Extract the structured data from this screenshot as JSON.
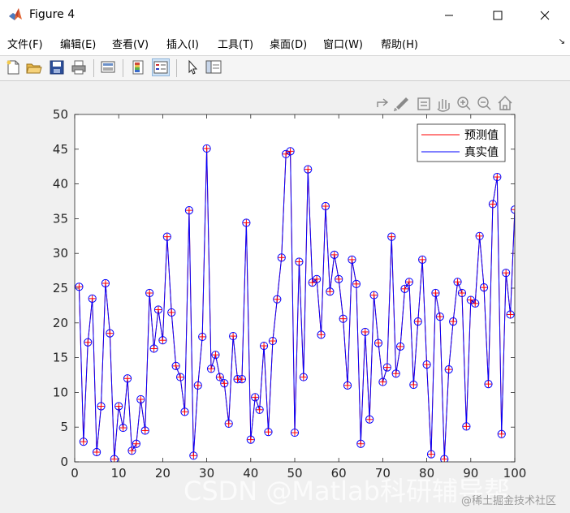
{
  "window": {
    "title": "Figure 4",
    "controls": {
      "minimize": "—",
      "maximize": "☐",
      "close": "✕"
    }
  },
  "menubar": {
    "items": [
      "文件(F)",
      "编辑(E)",
      "查看(V)",
      "插入(I)",
      "工具(T)",
      "桌面(D)",
      "窗口(W)",
      "帮助(H)"
    ]
  },
  "toolbar": {
    "buttons": [
      "new-figure-icon",
      "open-file-icon",
      "save-icon",
      "print-icon",
      "print-preview-icon",
      "colorbar-icon",
      "legend-icon",
      "pointer-icon",
      "property-inspector-icon"
    ]
  },
  "axes_toolbar": {
    "buttons": [
      "export-icon",
      "brush-icon",
      "data-tips-icon",
      "pan-icon",
      "zoom-in-icon",
      "zoom-out-icon",
      "home-icon"
    ]
  },
  "chart_data": {
    "type": "line",
    "xlim": [
      0,
      100
    ],
    "ylim": [
      0,
      50
    ],
    "xticks": [
      0,
      10,
      20,
      30,
      40,
      50,
      60,
      70,
      80,
      90,
      100
    ],
    "yticks": [
      0,
      5,
      10,
      15,
      20,
      25,
      30,
      35,
      40,
      45,
      50
    ],
    "grid": false,
    "legend_position": "top-right",
    "x": [
      1,
      2,
      3,
      4,
      5,
      6,
      7,
      8,
      9,
      10,
      11,
      12,
      13,
      14,
      15,
      16,
      17,
      18,
      19,
      20,
      21,
      22,
      23,
      24,
      25,
      26,
      27,
      28,
      29,
      30,
      31,
      32,
      33,
      34,
      35,
      36,
      37,
      38,
      39,
      40,
      41,
      42,
      43,
      44,
      45,
      46,
      47,
      48,
      49,
      50,
      51,
      52,
      53,
      54,
      55,
      56,
      57,
      58,
      59,
      60,
      61,
      62,
      63,
      64,
      65,
      66,
      67,
      68,
      69,
      70,
      71,
      72,
      73,
      74,
      75,
      76,
      77,
      78,
      79,
      80,
      81,
      82,
      83,
      84,
      85,
      86,
      87,
      88,
      89,
      90,
      91,
      92,
      93,
      94,
      95,
      96,
      97,
      98,
      99,
      100
    ],
    "series": [
      {
        "name": "预测值",
        "color": "#ff0000",
        "marker": "+",
        "values": [
          25.2,
          2.9,
          17.2,
          23.5,
          1.4,
          8,
          25.7,
          18.5,
          0.4,
          8,
          4.9,
          12,
          1.6,
          2.6,
          9,
          4.5,
          24.3,
          16.3,
          21.9,
          17.5,
          32.4,
          21.5,
          13.8,
          12.2,
          7.2,
          36.2,
          0.9,
          11,
          18,
          45.1,
          13.4,
          15.4,
          12.2,
          11.3,
          5.5,
          18.1,
          11.9,
          11.9,
          34.4,
          3.2,
          9.3,
          7.5,
          16.7,
          4.3,
          17.4,
          23.4,
          29.4,
          44.3,
          44.7,
          4.2,
          28.8,
          12.2,
          42.1,
          25.8,
          26.3,
          18.3,
          36.8,
          24.5,
          29.8,
          26.3,
          20.6,
          11,
          29.1,
          25.6,
          2.6,
          18.7,
          6.1,
          24,
          17.1,
          11.5,
          13.6,
          32.4,
          12.7,
          16.6,
          24.9,
          25.9,
          11.1,
          20.2,
          29.1,
          14,
          1.1,
          24.3,
          20.9,
          0.4,
          13.3,
          20.2,
          25.9,
          24.3,
          5.1,
          23.3,
          22.8,
          32.5,
          25.1,
          11.2,
          37.1,
          41,
          4,
          27.2,
          21.2,
          36.3
        ]
      },
      {
        "name": "真实值",
        "color": "#0000ff",
        "marker": "o",
        "values": [
          25.2,
          2.9,
          17.2,
          23.5,
          1.4,
          8,
          25.7,
          18.5,
          0.4,
          8,
          4.9,
          12,
          1.6,
          2.6,
          9,
          4.5,
          24.3,
          16.3,
          21.9,
          17.5,
          32.4,
          21.5,
          13.8,
          12.2,
          7.2,
          36.2,
          0.9,
          11,
          18,
          45.1,
          13.4,
          15.4,
          12.2,
          11.3,
          5.5,
          18.1,
          11.9,
          11.9,
          34.4,
          3.2,
          9.3,
          7.5,
          16.7,
          4.3,
          17.4,
          23.4,
          29.4,
          44.3,
          44.7,
          4.2,
          28.8,
          12.2,
          42.1,
          25.8,
          26.3,
          18.3,
          36.8,
          24.5,
          29.8,
          26.3,
          20.6,
          11,
          29.1,
          25.6,
          2.6,
          18.7,
          6.1,
          24,
          17.1,
          11.5,
          13.6,
          32.4,
          12.7,
          16.6,
          24.9,
          25.9,
          11.1,
          20.2,
          29.1,
          14,
          1.1,
          24.3,
          20.9,
          0.4,
          13.3,
          20.2,
          25.9,
          24.3,
          5.1,
          23.3,
          22.8,
          32.5,
          25.1,
          11.2,
          37.1,
          41,
          4,
          27.2,
          21.2,
          36.3
        ]
      }
    ]
  },
  "watermarks": {
    "csdn": "CSDN @Matlab科研辅导帮",
    "juejin": "@稀土掘金技术社区"
  }
}
